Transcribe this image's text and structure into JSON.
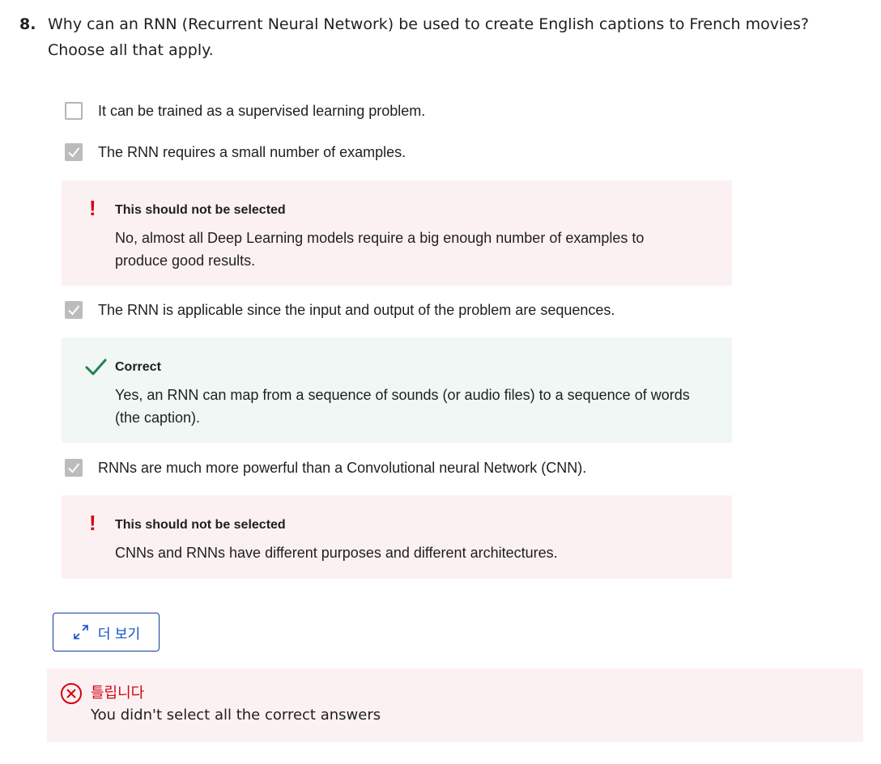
{
  "question": {
    "number": "8.",
    "text": "Why can an RNN (Recurrent Neural Network) be used to create English captions to French movies? Choose all that apply."
  },
  "options": [
    {
      "label": "It can be trained as a supervised learning problem.",
      "checked": false
    },
    {
      "label": "The RNN requires a small number of examples.",
      "checked": true
    },
    {
      "label": "The RNN is applicable since the input and output of the problem are sequences.",
      "checked": true
    },
    {
      "label": "RNNs are much more powerful than a Convolutional neural Network (CNN).",
      "checked": true
    }
  ],
  "feedback": [
    {
      "status": "wrong",
      "icon": "exclamation-icon",
      "icon_glyph": "!",
      "title": "This should not be selected",
      "body": "No, almost all Deep Learning models require a big enough number of examples to produce good results."
    },
    {
      "status": "correct",
      "icon": "checkmark-icon",
      "title": "Correct",
      "body": "Yes, an RNN can map from a sequence of sounds (or audio files) to a sequence of words (the caption)."
    },
    {
      "status": "wrong",
      "icon": "exclamation-icon",
      "icon_glyph": "!",
      "title": "This should not be selected",
      "body": "CNNs and RNNs have different purposes and different architectures."
    }
  ],
  "more_button": {
    "label": "더 보기",
    "icon": "expand-icon"
  },
  "result": {
    "icon": "x-circle-icon",
    "title": "틀립니다",
    "body": "You didn't select all the correct answers"
  },
  "colors": {
    "error_red": "#d30012",
    "correct_green": "#1f8354",
    "wrong_bg": "#fcf1f2",
    "correct_bg": "#f0f7f4",
    "link_blue": "#0f4fc4",
    "checkbox_checked": "#bcbcbc"
  }
}
